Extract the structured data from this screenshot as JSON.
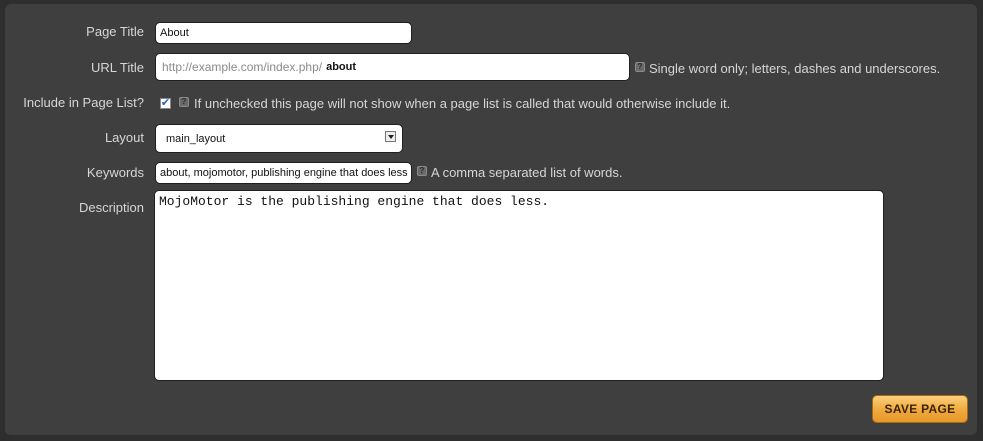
{
  "form": {
    "page_title": {
      "label": "Page Title",
      "value": "About"
    },
    "url_title": {
      "label": "URL Title",
      "prefix": "http://example.com/index.php/",
      "value": "about",
      "help": "Single word only; letters, dashes and underscores."
    },
    "include_in_page_list": {
      "label": "Include in Page List?",
      "checked": true,
      "help": "If unchecked this page will not show when a page list is called that would otherwise include it."
    },
    "layout": {
      "label": "Layout",
      "selected": "main_layout"
    },
    "keywords": {
      "label": "Keywords",
      "value": "about, mojomotor, publishing engine that does less",
      "help": "A comma separated list of words."
    },
    "description": {
      "label": "Description",
      "value": "MojoMotor is the publishing engine that does less."
    },
    "help_icon_glyph": "?",
    "checkmark_glyph": "✔",
    "save_button": "SAVE PAGE"
  },
  "colors": {
    "panel_bg": "#3f3f3f",
    "label_text": "#d6d6d6",
    "save_button_bg": "#f0a83c"
  },
  "icons": [
    "help-icon",
    "checkbox-check-icon",
    "dropdown-arrow-icon"
  ]
}
